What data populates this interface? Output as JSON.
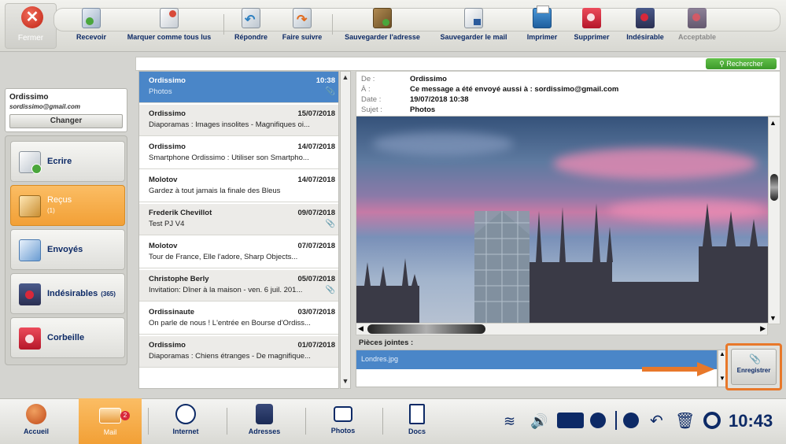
{
  "toolbar": {
    "close": "Fermer",
    "items": [
      {
        "label": "Recevoir",
        "icon": "receive-icon"
      },
      {
        "label": "Marquer comme tous lus",
        "icon": "mark-read-icon"
      },
      {
        "label": "Répondre",
        "icon": "reply-icon"
      },
      {
        "label": "Faire suivre",
        "icon": "forward-icon"
      },
      {
        "label": "Sauvegarder l'adresse",
        "icon": "save-address-icon"
      },
      {
        "label": "Sauvegarder le mail",
        "icon": "save-mail-icon"
      },
      {
        "label": "Imprimer",
        "icon": "print-icon"
      },
      {
        "label": "Supprimer",
        "icon": "delete-icon"
      },
      {
        "label": "Indésirable",
        "icon": "junk-icon"
      },
      {
        "label": "Acceptable",
        "icon": "acceptable-icon"
      }
    ]
  },
  "account": {
    "name": "Ordissimo",
    "email": "sordissimo@gmail.com",
    "change": "Changer"
  },
  "folders": [
    {
      "label": "Ecrire",
      "count": ""
    },
    {
      "label": "Reçus",
      "count": "(1)"
    },
    {
      "label": "Envoyés",
      "count": ""
    },
    {
      "label": "Indésirables",
      "count": "(365)"
    },
    {
      "label": "Corbeille",
      "count": ""
    }
  ],
  "search": {
    "label": "Rechercher"
  },
  "messages": [
    {
      "from": "Ordissimo",
      "date": "10:38",
      "subject": "Photos",
      "attachment": true
    },
    {
      "from": "Ordissimo",
      "date": "15/07/2018",
      "subject": "Diaporamas : Images insolites - Magnifiques oi...",
      "attachment": false
    },
    {
      "from": "Ordissimo",
      "date": "14/07/2018",
      "subject": "Smartphone Ordissimo : Utiliser son Smartpho...",
      "attachment": false
    },
    {
      "from": "Molotov",
      "date": "14/07/2018",
      "subject": "Gardez à tout jamais la finale des Bleus",
      "attachment": false
    },
    {
      "from": "Frederik Chevillot",
      "date": "09/07/2018",
      "subject": "Test PJ V4",
      "attachment": true
    },
    {
      "from": "Molotov",
      "date": "07/07/2018",
      "subject": "Tour de France, Elle l'adore, Sharp Objects...",
      "attachment": false
    },
    {
      "from": "Christophe Berly",
      "date": "05/07/2018",
      "subject": "Invitation: Dîner à la maison - ven. 6 juil. 201...",
      "attachment": true
    },
    {
      "from": "Ordissinaute",
      "date": "03/07/2018",
      "subject": "On parle de nous ! L'entrée en Bourse d'Ordiss...",
      "attachment": false
    },
    {
      "from": "Ordissimo",
      "date": "01/07/2018",
      "subject": "Diaporamas : Chiens étranges - De magnifique...",
      "attachment": false
    }
  ],
  "header": {
    "from_key": "De :",
    "from": "Ordissimo",
    "to_key": "À :",
    "to": "Ce message a été envoyé aussi à : sordissimo@gmail.com",
    "date_key": "Date :",
    "date": "19/07/2018 10:38",
    "subject_key": "Sujet :",
    "subject": "Photos"
  },
  "attachments": {
    "label": "Pièces jointes :",
    "items": [
      "Londres.jpg"
    ],
    "save": "Enregistrer"
  },
  "taskbar": {
    "items": [
      {
        "label": "Accueil"
      },
      {
        "label": "Mail",
        "badge": "2"
      },
      {
        "label": "Internet"
      },
      {
        "label": "Adresses"
      },
      {
        "label": "Photos"
      },
      {
        "label": "Docs"
      }
    ],
    "clock": "10:43"
  },
  "colors": {
    "accent": "#f2a036",
    "selection": "#4a86c8",
    "label": "#0d2a66",
    "highlight": "#e8782a"
  }
}
